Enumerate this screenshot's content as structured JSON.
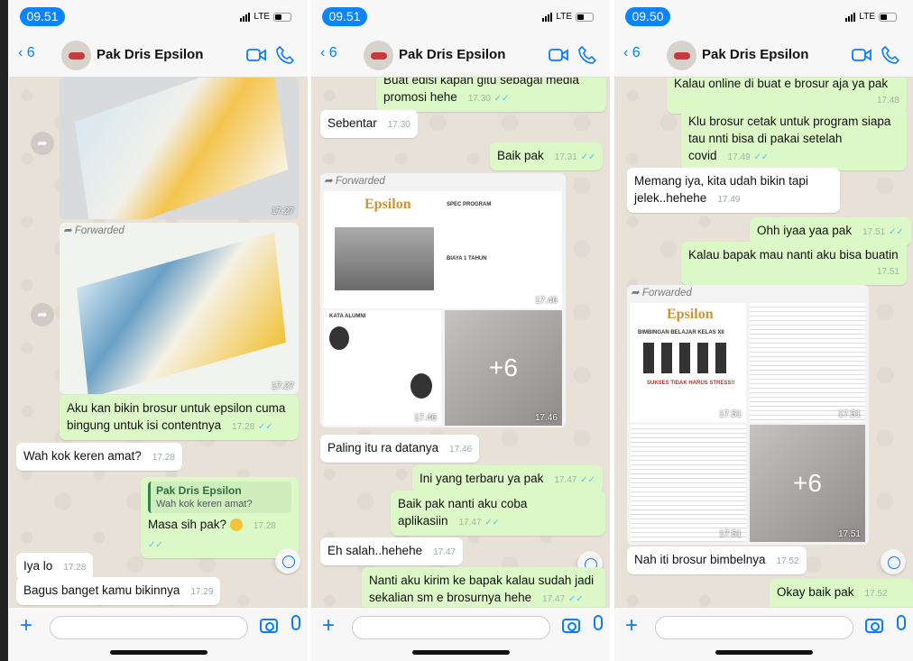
{
  "screens": [
    {
      "time": "09.51",
      "net": "LTE",
      "back": "6",
      "name": "Pak Dris Epsilon",
      "input_placeholder": ""
    },
    {
      "time": "09.51",
      "net": "LTE",
      "back": "6",
      "name": "Pak Dris Epsilon",
      "input_placeholder": ""
    },
    {
      "time": "09.50",
      "net": "LTE",
      "back": "6",
      "name": "Pak Dris Epsilon",
      "input_placeholder": ""
    }
  ],
  "c1": {
    "t1": "17.27",
    "fwd": "Forwarded",
    "t2": "17.27",
    "m1": "Aku kan bikin brosur untuk epsilon cuma bingung untuk isi contentnya",
    "m1t": "17.28",
    "m2": "Wah kok keren amat?",
    "m2t": "17.28",
    "qname": "Pak Dris Epsilon",
    "qtext": "Wah kok keren amat?",
    "m3": "Masa sih pak?",
    "m3t": "17.28",
    "m4": "Iya lo",
    "m4t": "17.28",
    "m5": "Bagus banget kamu bikinnya",
    "m5t": "17.29"
  },
  "c2": {
    "m0": "Buat edisi kapan gitu sebagai media promosi hehe",
    "m0t": "17.30",
    "m1": "Sebentar",
    "m1t": "17.30",
    "m2": "Baik pak",
    "m2t": "17.31",
    "fwd": "Forwarded",
    "i1": "17.46",
    "i2": "17.46",
    "i3": "17.46",
    "plus": "+6",
    "logo": "Epsilon",
    "spec": "SPEC PROGRAM",
    "alumni": "KATA ALUMNI",
    "biaya": "BIAYA 1 TAHUN",
    "m3": "Paling itu ra datanya",
    "m3t": "17.46",
    "m4": "Ini yang terbaru ya pak",
    "m4t": "17.47",
    "m5": "Baik pak nanti aku coba aplikasiin",
    "m5t": "17.47",
    "m6": "Eh salah..hehehe",
    "m6t": "17.47",
    "m7": "Nanti aku kirim ke bapak kalau sudah jadi sekalian sm e brosurnya hehe",
    "m7t": "17.47"
  },
  "c3": {
    "m1": "Kalau online di buat e brosur aja ya pak",
    "m1t": "17.48",
    "m2": "Klu brosur cetak untuk program siapa tau nnti bisa di pakai setelah covid",
    "m2t": "17.49",
    "m3": "Memang iya, kita udah bikin tapi jelek..hehehe",
    "m3t": "17.49",
    "m4": "Ohh iyaa yaa pak",
    "m4t": "17.51",
    "m5": "Kalau bapak mau nanti aku bisa buatin",
    "m5t": "17.51",
    "fwd": "Forwarded",
    "logo": "Epsilon",
    "bimb": "BIMBINGAN BELAJAR KELAS XII",
    "sukses": "SUKSES TIDAK HARUS STRESS!!",
    "i1": "17.51",
    "i2": "17.51",
    "i3": "17.51",
    "i4": "17.51",
    "plus": "+6",
    "m6": "Nah iti brosur bimbelnya",
    "m6t": "17.52",
    "m7": "Okay baik pak",
    "m7t": "17.52"
  }
}
